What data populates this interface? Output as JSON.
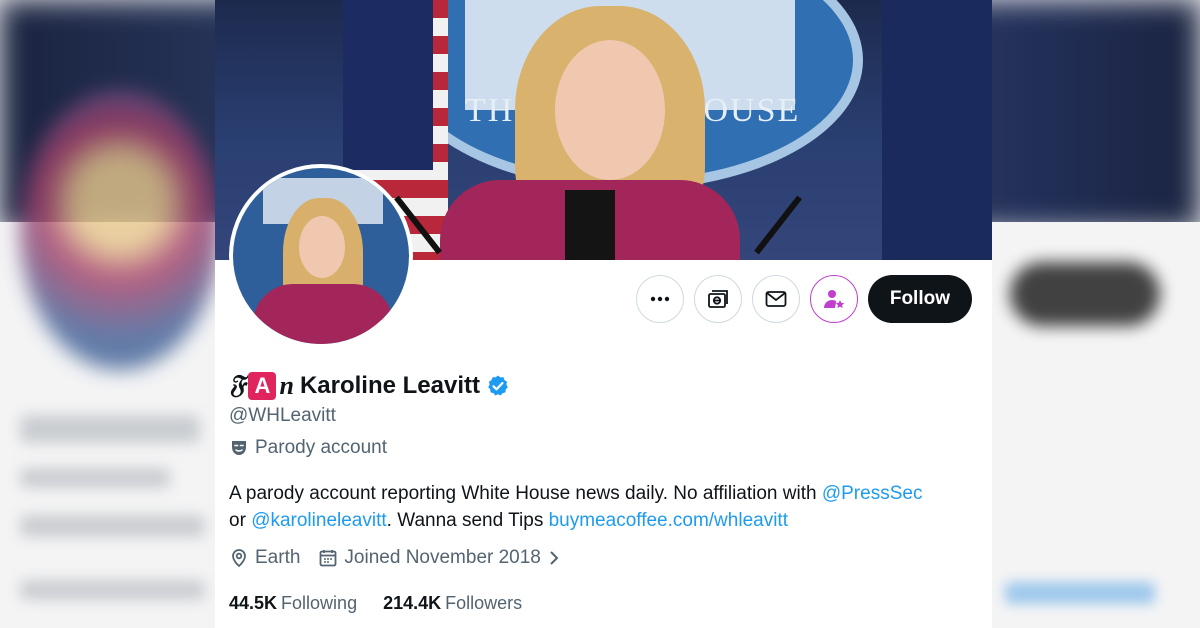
{
  "profile": {
    "name_prefix": {
      "fancy_f": "𝔉",
      "a_badge": "A",
      "fancy_n": "n"
    },
    "display_name": "Karoline Leavitt",
    "verified_icon": "verified-badge-icon",
    "handle": "@WHLeavitt",
    "parody_label": "Parody account",
    "bio": {
      "part1": "A parody account reporting White House news daily. No affiliation with ",
      "mention1": "@PressSec",
      "part2": "or ",
      "mention2": "@karolineleavitt",
      "part3": ". Wanna send Tips ",
      "link": "buymeacoffee.com/whleavitt"
    },
    "location": "Earth",
    "joined": "Joined November 2018",
    "following_count": "44.5K",
    "following_label": "Following",
    "followers_count": "214.4K",
    "followers_label": "Followers"
  },
  "banner": {
    "text": "THE WHITE HOUSE"
  },
  "actions": {
    "more_icon": "more-dots-icon",
    "grok_icon": "grok-icon",
    "message_icon": "envelope-icon",
    "subscribe_icon": "subscribe-person-star-icon",
    "follow_label": "Follow"
  },
  "colors": {
    "link": "#1d9bf0",
    "follow_bg": "#0f1419",
    "subscribe_accent": "#c13fcf",
    "verified": "#1d9bf0"
  }
}
